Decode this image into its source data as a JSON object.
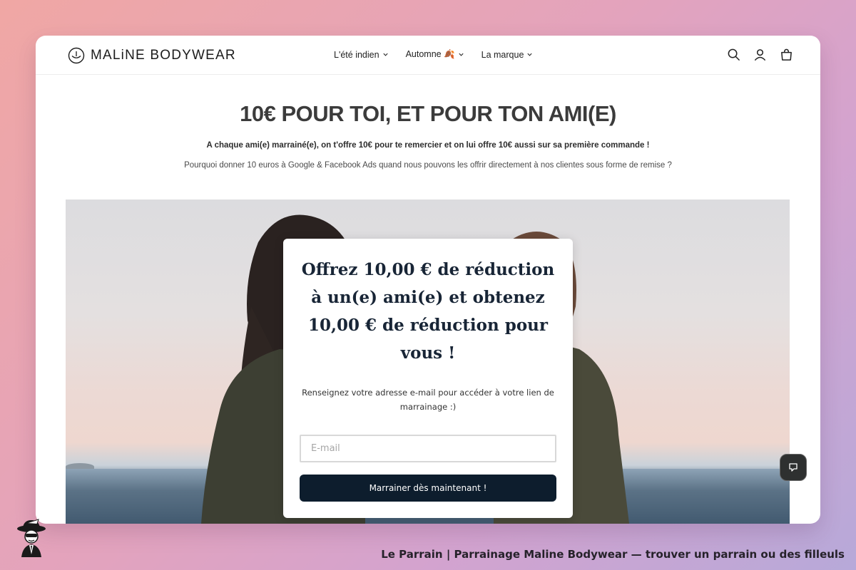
{
  "header": {
    "logo_text": "MALiNE BODYWEAR",
    "nav": [
      {
        "label": "L'été indien"
      },
      {
        "label": "Automne 🍂"
      },
      {
        "label": "La marque"
      }
    ],
    "icons": [
      "search-icon",
      "account-icon",
      "cart-icon"
    ]
  },
  "hero": {
    "headline": "10€ POUR TOI, ET POUR TON AMI(E)",
    "lead": "A chaque ami(e) marrainé(e), on t'offre 10€ pour te remercier et on lui offre 10€ aussi sur sa première commande !",
    "sub": "Pourquoi donner 10 euros à Google & Facebook Ads quand nous pouvons les offrir directement à nos clientes sous forme de remise ?"
  },
  "referral": {
    "title": "Offrez 10,00 € de réduction à un(e) ami(e) et obtenez 10,00 € de réduction pour vous !",
    "text": "Renseignez votre adresse e-mail pour accéder à votre lien de marrainage :)",
    "email_placeholder": "E-mail",
    "email_value": "",
    "button_label": "Marrainer dès maintenant !"
  },
  "caption": "Le Parrain | Parrainage Maline Bodywear — trouver un parrain ou des filleuls",
  "colors": {
    "button_bg": "#0d1d2d",
    "headline": "#3b3b3b",
    "card_title": "#182536"
  }
}
